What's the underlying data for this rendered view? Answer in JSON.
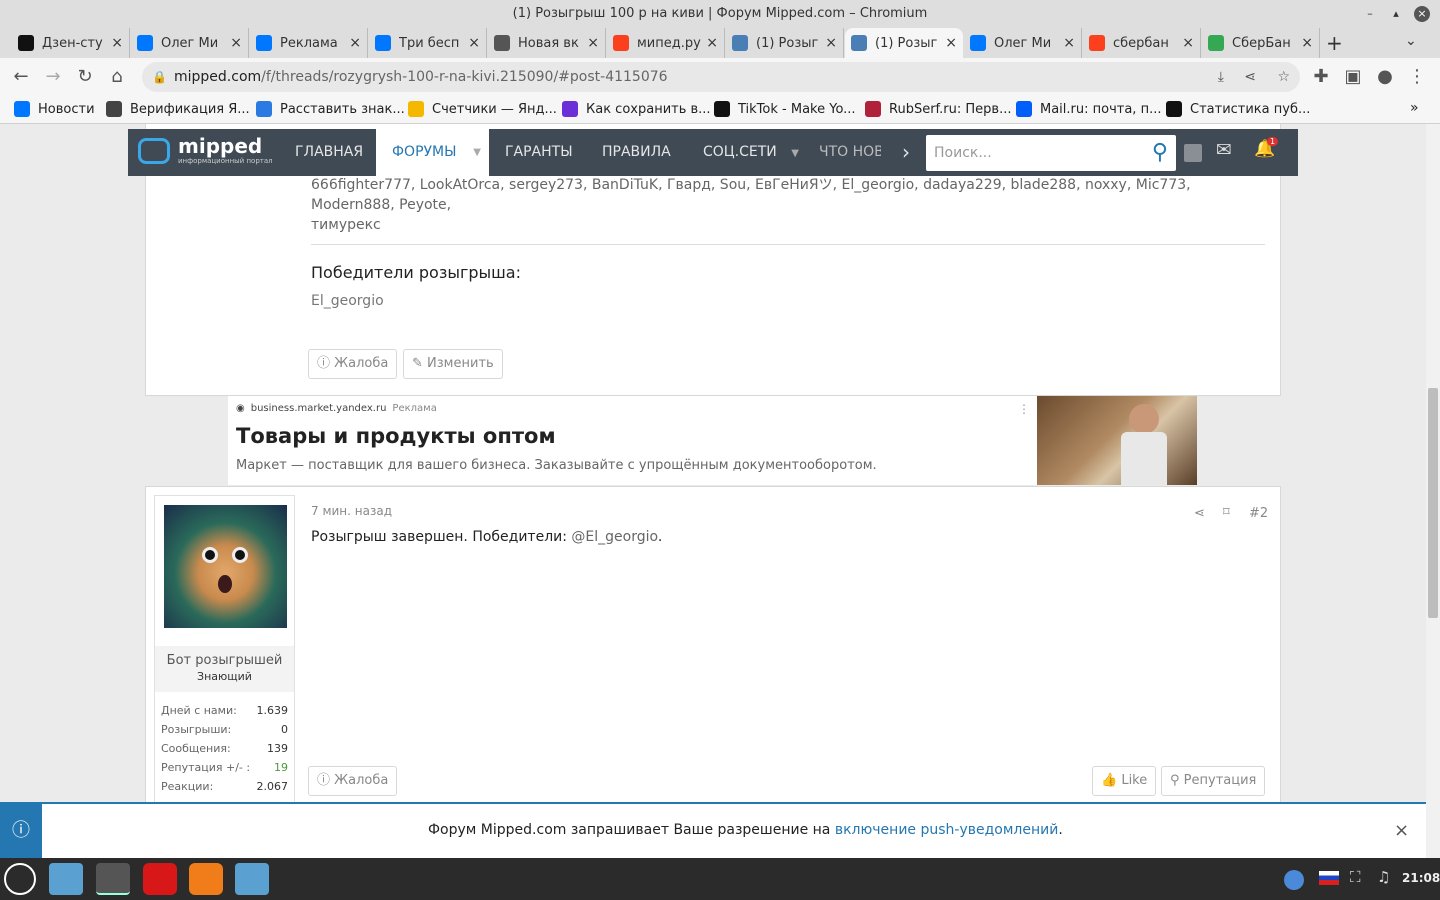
{
  "window": {
    "title": "(1) Розыгрыш 100 р на киви | Форум Mipped.com – Chromium"
  },
  "tabs": [
    {
      "label": "Дзен-сту",
      "icon": "zen-icon",
      "color": "#111111",
      "active": false
    },
    {
      "label": "Олег Ми",
      "icon": "vk-icon",
      "color": "#0077ff",
      "active": false
    },
    {
      "label": "Реклама",
      "icon": "vk-icon",
      "color": "#0077ff",
      "active": false
    },
    {
      "label": "Три бесп",
      "icon": "vk-icon",
      "color": "#0077ff",
      "active": false
    },
    {
      "label": "Новая вк",
      "icon": "chromium-icon",
      "color": "#555555",
      "active": false
    },
    {
      "label": "мипед.ру",
      "icon": "yandex-icon",
      "color": "#fc3f1d",
      "active": false
    },
    {
      "label": "(1) Розыг",
      "icon": "mipped-icon",
      "color": "#4a7fb5",
      "active": false
    },
    {
      "label": "(1) Розыг",
      "icon": "mipped-icon",
      "color": "#4a7fb5",
      "active": true
    },
    {
      "label": "Олег Ми",
      "icon": "vk-icon",
      "color": "#0077ff",
      "active": false
    },
    {
      "label": "сбербан",
      "icon": "yandex-icon",
      "color": "#fc3f1d",
      "active": false
    },
    {
      "label": "СберБан",
      "icon": "google-icon",
      "color": "#34a853",
      "active": false
    }
  ],
  "toolbar": {
    "url_host": "mipped.com",
    "url_path": "/f/threads/rozygrysh-100-r-na-kivi.215090/#post-4115076"
  },
  "bookmarks": [
    {
      "label": "Новости",
      "color": "#0077ff"
    },
    {
      "label": "Верификация Я...",
      "color": "#444444"
    },
    {
      "label": "Расставить знак...",
      "color": "#2a7ae2"
    },
    {
      "label": "Счетчики — Янд...",
      "color": "#f5b800"
    },
    {
      "label": "Как сохранить в...",
      "color": "#6c2ed6"
    },
    {
      "label": "TikTok - Make Yo...",
      "color": "#111111"
    },
    {
      "label": "RubSerf.ru: Перв...",
      "color": "#b0213a"
    },
    {
      "label": "Mail.ru: почта, п...",
      "color": "#005ff9"
    },
    {
      "label": "Статистика пуб...",
      "color": "#111111"
    }
  ],
  "site": {
    "logo": "mipped",
    "logo_sub": "информационный портал",
    "nav": [
      "ГЛАВНАЯ",
      "ФОРУМЫ",
      "ГАРАНТЫ",
      "ПРАВИЛА",
      "СОЦ.СЕТИ",
      "ЧТО НОВ"
    ],
    "search_placeholder": "Поиск...",
    "alerts_badge": "1"
  },
  "post1": {
    "participants": "666fighter777, LookAtOrca, sergey273, BanDiTuK, Гвард, Sou, ЕвГеНиЯツ, El_georgio, dadaya229, blade288, noxxy, Mic773, Modern888, Peyote,",
    "participants2": "тимурекс",
    "winners_title": "Победители розыгрыша:",
    "winner": "El_georgio",
    "report": "Жалоба",
    "edit": "Изменить"
  },
  "ad": {
    "domain": "business.market.yandex.ru",
    "tag": "Реклама",
    "title": "Товары и продукты оптом",
    "text": "Маркет — поставщик для вашего бизнеса. Заказывайте с упрощённым документооборотом."
  },
  "post2": {
    "time": "7 мин. назад",
    "num": "#2",
    "text_pre": "Розыгрыш завершен. Победители: ",
    "mention": "@El_georgio",
    "text_post": ".",
    "user": "Бот розыгрышей",
    "rank": "Знающий",
    "stats": [
      {
        "label": "Дней с нами:",
        "value": "1.639",
        "color": "#333333"
      },
      {
        "label": "Розыгрыши:",
        "value": "0",
        "color": "#333333"
      },
      {
        "label": "Сообщения:",
        "value": "139",
        "color": "#333333"
      },
      {
        "label": "Репутация +/- :",
        "value": "19",
        "color": "#4a9a3a"
      },
      {
        "label": "Реакции:",
        "value": "2.067",
        "color": "#333333"
      }
    ],
    "report": "Жалоба",
    "like": "Like",
    "rep": "Репутация"
  },
  "notification": {
    "pre": "Форум Mipped.com запрашивает Ваше разрешение на ",
    "link": "включение push-уведомлений",
    "post": "."
  },
  "taskbar": {
    "time": "21:08"
  }
}
